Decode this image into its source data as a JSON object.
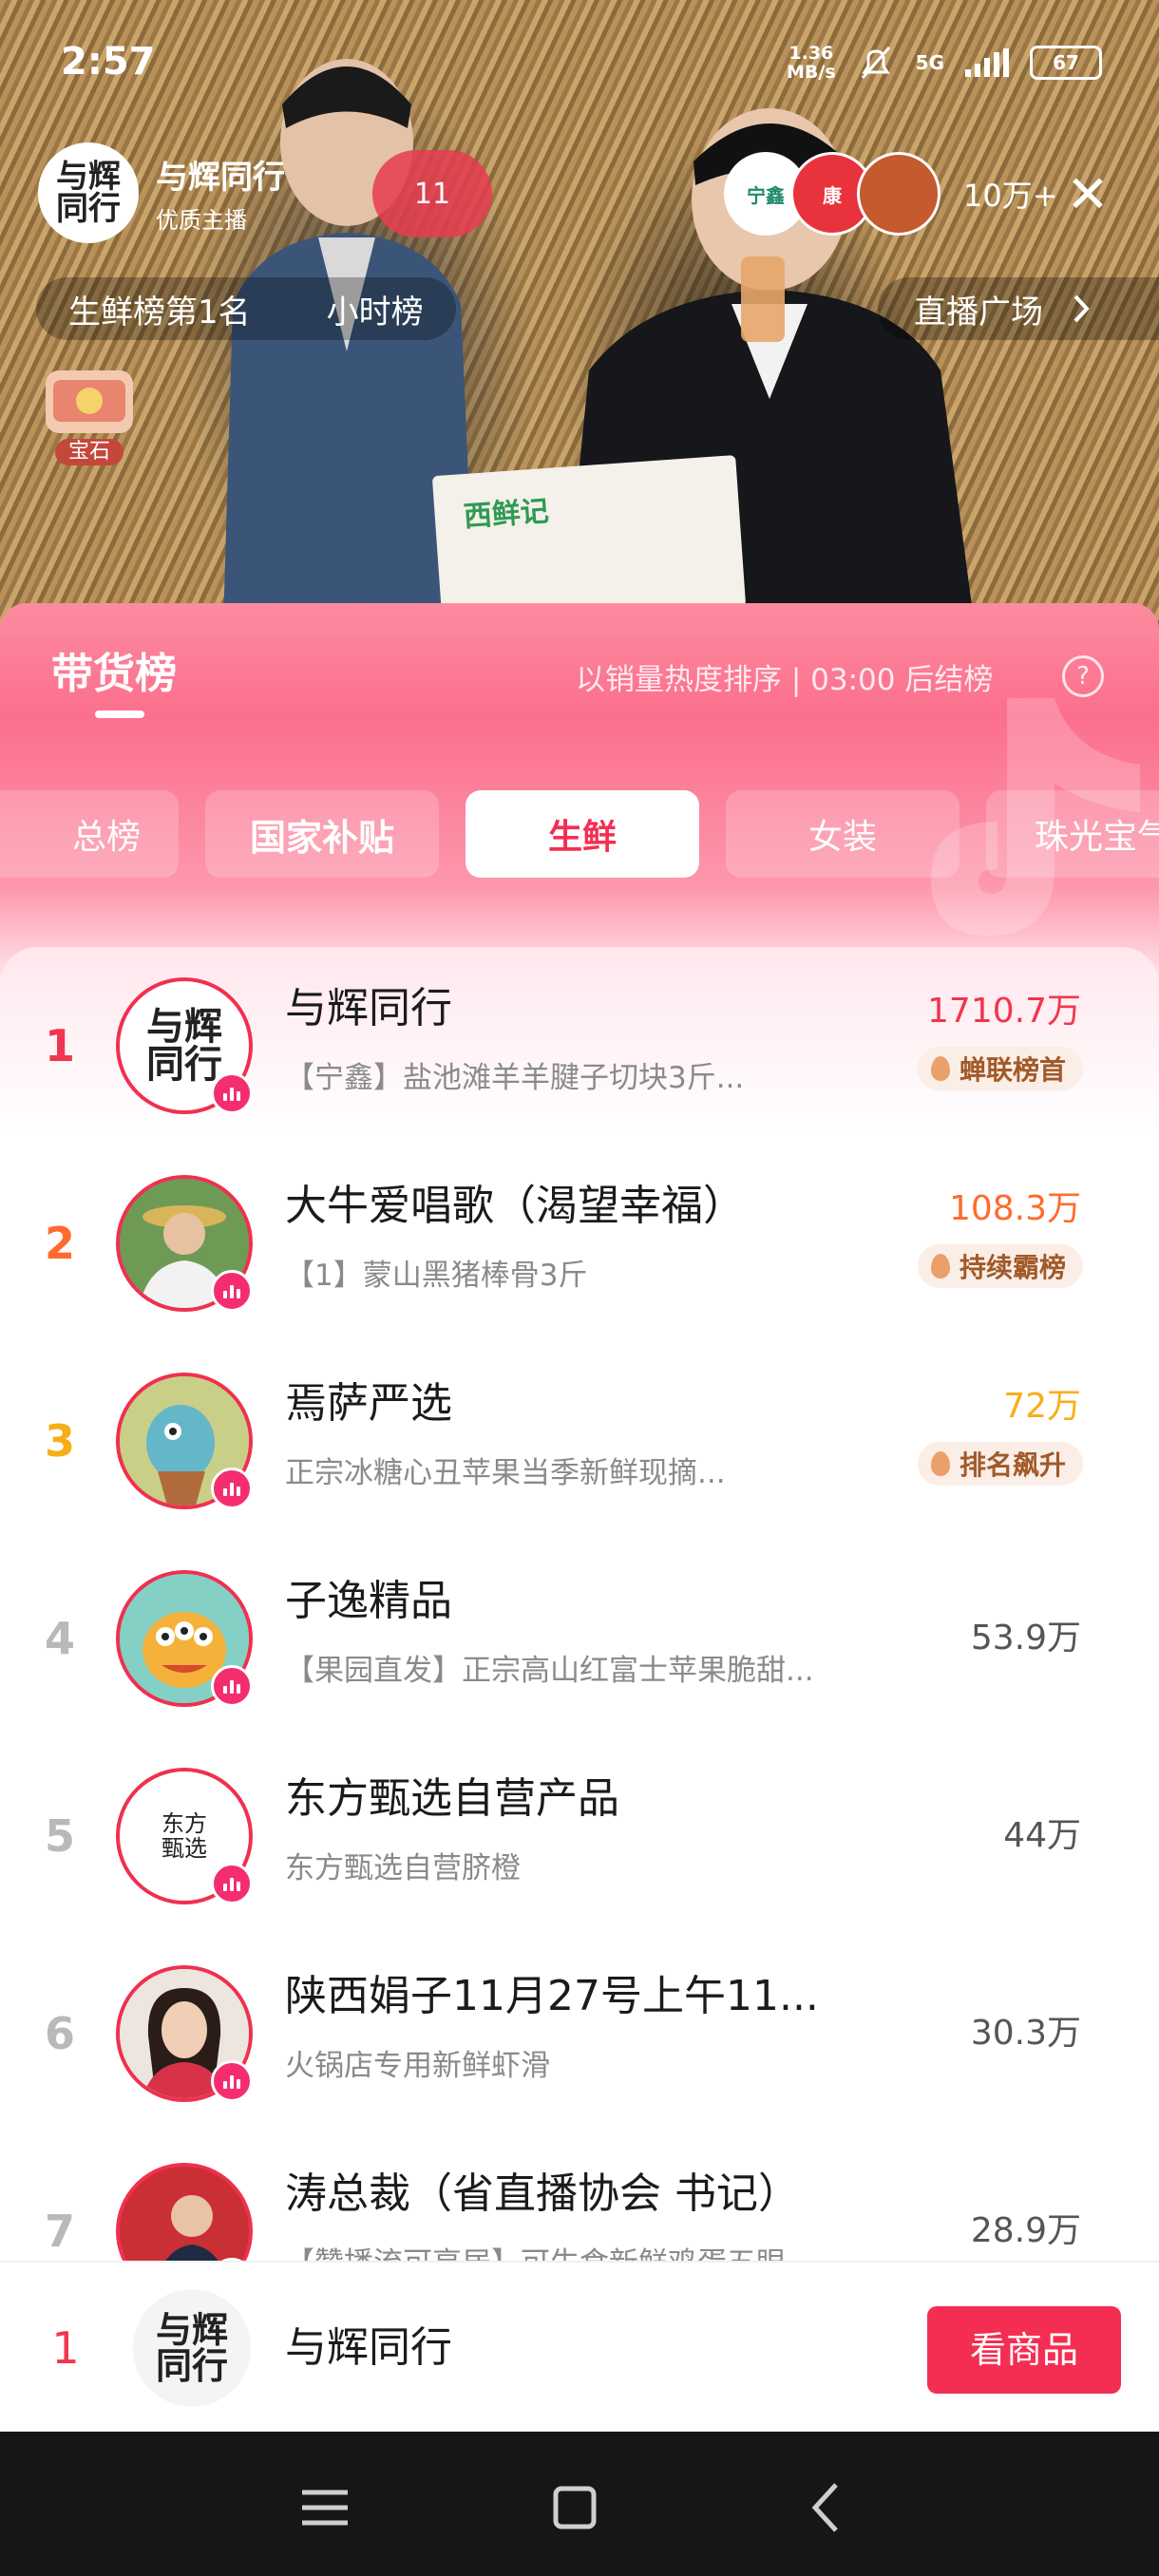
{
  "status_bar": {
    "time": "2:57",
    "net_speed_value": "1.36",
    "net_speed_unit": "MB/s",
    "signal": "5G",
    "battery": "67"
  },
  "live": {
    "host_name": "与辉同行",
    "host_tag": "优质主播",
    "host_logo_line1": "与辉",
    "host_logo_line2": "同行",
    "like_count": "11",
    "viewer_count": "10万+",
    "viewer_avatar_1": "宁鑫",
    "viewer_avatar_2": "康",
    "rank_chip_1": "生鲜榜第1名",
    "rank_chip_2": "小时榜",
    "plaza_label": "直播广场",
    "gem_label": "宝石",
    "poster_text": "西鲜记"
  },
  "panel": {
    "title": "带货榜",
    "note": "以销量热度排序 | 03:00 后结榜",
    "help": "?",
    "tabs": [
      {
        "label": "总榜"
      },
      {
        "label": "国家补贴"
      },
      {
        "label": "生鲜"
      },
      {
        "label": "女装"
      },
      {
        "label": "珠光宝气"
      }
    ],
    "active_tab": "生鲜"
  },
  "ranking": [
    {
      "rank": "1",
      "name": "与辉同行",
      "product": "【宁鑫】盐池滩羊羊腱子切块3斤...",
      "sales": "1710.7万",
      "tag": "蝉联榜首"
    },
    {
      "rank": "2",
      "name": "大牛爱唱歌（渴望幸福）",
      "product": "【1】蒙山黑猪棒骨3斤",
      "sales": "108.3万",
      "tag": "持续霸榜"
    },
    {
      "rank": "3",
      "name": "焉萨严选",
      "product": "正宗冰糖心丑苹果当季新鲜现摘...",
      "sales": "72万",
      "tag": "排名飙升"
    },
    {
      "rank": "4",
      "name": "子逸精品",
      "product": "【果园直发】正宗高山红富士苹果脆甜...",
      "sales": "53.9万"
    },
    {
      "rank": "5",
      "name": "东方甄选自营产品",
      "product": "东方甄选自营脐橙",
      "sales": "44万",
      "avatar_text": "东方甄选"
    },
    {
      "rank": "6",
      "name": "陕西娟子11月27号上午11...",
      "product": "火锅店专用新鲜虾滑",
      "sales": "30.3万"
    },
    {
      "rank": "7",
      "name": "涛总裁（省直播协会 书记）",
      "product": "【赞播流可享居】可生食新鲜鸡蛋五眼",
      "sales": "28.9万"
    }
  ],
  "my_bar": {
    "rank": "1",
    "name": "与辉同行",
    "button": "看商品"
  },
  "colors": {
    "accent": "#f42e52",
    "rank1": "#f2354f",
    "rank2": "#ff6b2e",
    "rank3": "#f8ae16",
    "tag_bg": "#fbeee6"
  },
  "icons": {
    "close": "close-icon",
    "chevron": "chevron-right-icon",
    "help": "help-circle-icon",
    "menu": "menu-icon",
    "home": "home-square-icon",
    "back": "back-icon"
  }
}
